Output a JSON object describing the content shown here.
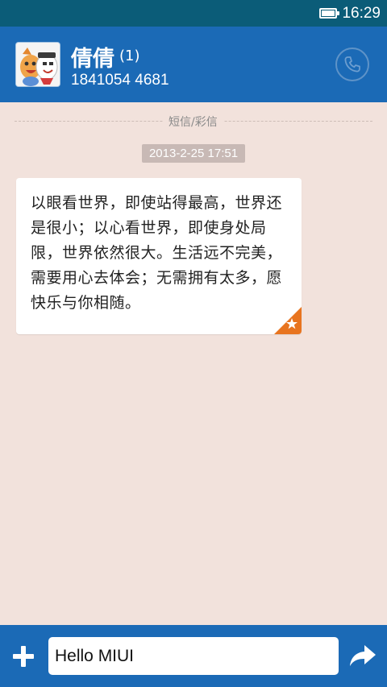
{
  "status_bar": {
    "time": "16:29",
    "battery_icon": "battery-full-icon"
  },
  "header": {
    "contact_name": "倩倩",
    "unread_count": "(1)",
    "phone_number": "1841054 4681",
    "avatar_icon": "cartoon-avatar-icon",
    "call_icon": "phone-icon"
  },
  "thread": {
    "type_label": "短信/彩信",
    "timestamp": "2013-2-25 17:51",
    "messages": [
      {
        "text": "以眼看世界，即使站得最高，世界还是很小；以心看世界，即使身处局限，世界依然很大。生活远不完美，需要用心去体会；无需拥有太多，愿快乐与你相随。",
        "starred": true
      }
    ]
  },
  "composer": {
    "value": "Hello MIUI",
    "add_icon": "plus-icon",
    "send_icon": "send-arrow-icon"
  },
  "colors": {
    "status_bar": "#0b5c78",
    "header": "#1b6ab6",
    "background": "#f2e2dc",
    "star_accent": "#e8741f"
  }
}
